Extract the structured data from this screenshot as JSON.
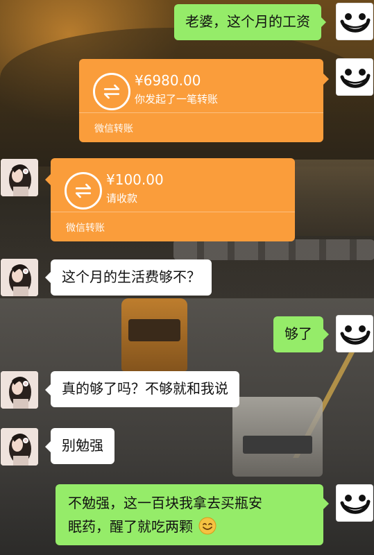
{
  "messages": [
    {
      "id": "m1",
      "side": "me",
      "type": "text",
      "text": "老婆，这个月的工资"
    },
    {
      "id": "m2",
      "side": "me",
      "type": "transfer",
      "amount": "¥6980.00",
      "subtitle": "你发起了一笔转账",
      "footer": "微信转账"
    },
    {
      "id": "m3",
      "side": "her",
      "type": "transfer",
      "amount": "¥100.00",
      "subtitle": "请收款",
      "footer": "微信转账"
    },
    {
      "id": "m4",
      "side": "her",
      "type": "text",
      "text": "这个月的生活费够不？"
    },
    {
      "id": "m5",
      "side": "me",
      "type": "text",
      "text": "够了"
    },
    {
      "id": "m6",
      "side": "her",
      "type": "text",
      "text": "真的够了吗？不够就和我说"
    },
    {
      "id": "m7",
      "side": "her",
      "type": "text",
      "text": "别勉强"
    },
    {
      "id": "m8",
      "side": "me",
      "type": "text",
      "text_line1": "不勉强，这一百块我拿去买瓶安",
      "text_line2": "眠药，醒了就吃两颗",
      "emoji": "smile-emoji"
    }
  ],
  "icons": {
    "me_avatar": "smiley-face-icon",
    "her_avatar": "girl-portrait-icon",
    "transfer": "transfer-arrows-icon"
  },
  "colors": {
    "bubble_me": "#95ec69",
    "bubble_her": "#ffffff",
    "transfer": "#fa9d3b",
    "emoji": "#f5c242"
  }
}
